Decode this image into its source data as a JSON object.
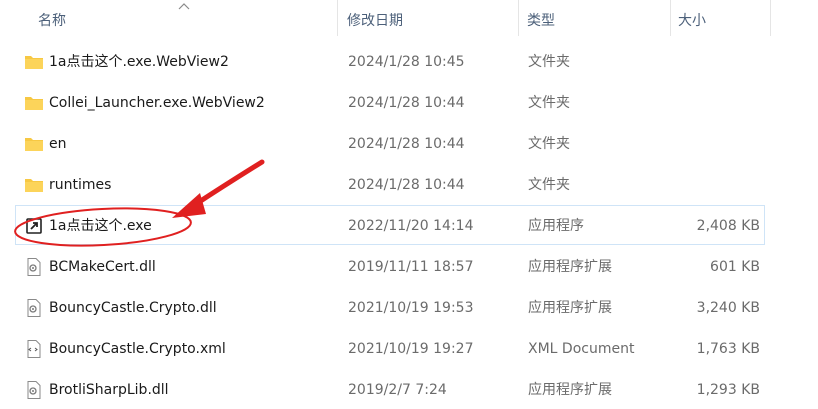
{
  "columns": {
    "name": "名称",
    "date": "修改日期",
    "type": "类型",
    "size": "大小"
  },
  "files": [
    {
      "icon": "folder-icon",
      "name": "1a点击这个.exe.WebView2",
      "date": "2024/1/28 10:45",
      "type": "文件夹",
      "size": ""
    },
    {
      "icon": "folder-icon",
      "name": "Collei_Launcher.exe.WebView2",
      "date": "2024/1/28 10:44",
      "type": "文件夹",
      "size": ""
    },
    {
      "icon": "folder-icon",
      "name": "en",
      "date": "2024/1/28 10:44",
      "type": "文件夹",
      "size": ""
    },
    {
      "icon": "folder-icon",
      "name": "runtimes",
      "date": "2024/1/28 10:44",
      "type": "文件夹",
      "size": ""
    },
    {
      "icon": "shortcut-app-icon",
      "name": "1a点击这个.exe",
      "date": "2022/11/20 14:14",
      "type": "应用程序",
      "size": "2,408 KB"
    },
    {
      "icon": "dll-file-icon",
      "name": "BCMakeCert.dll",
      "date": "2019/11/11 18:57",
      "type": "应用程序扩展",
      "size": "601 KB"
    },
    {
      "icon": "dll-file-icon",
      "name": "BouncyCastle.Crypto.dll",
      "date": "2021/10/19 19:53",
      "type": "应用程序扩展",
      "size": "3,240 KB"
    },
    {
      "icon": "xml-file-icon",
      "name": "BouncyCastle.Crypto.xml",
      "date": "2021/10/19 19:27",
      "type": "XML Document",
      "size": "1,763 KB"
    },
    {
      "icon": "dll-file-icon",
      "name": "BrotliSharpLib.dll",
      "date": "2019/2/7 7:24",
      "type": "应用程序扩展",
      "size": "1,293 KB"
    }
  ],
  "colors": {
    "folder": "#f7c843",
    "annotation": "#e02020",
    "selection_border": "#cfe4f7"
  }
}
